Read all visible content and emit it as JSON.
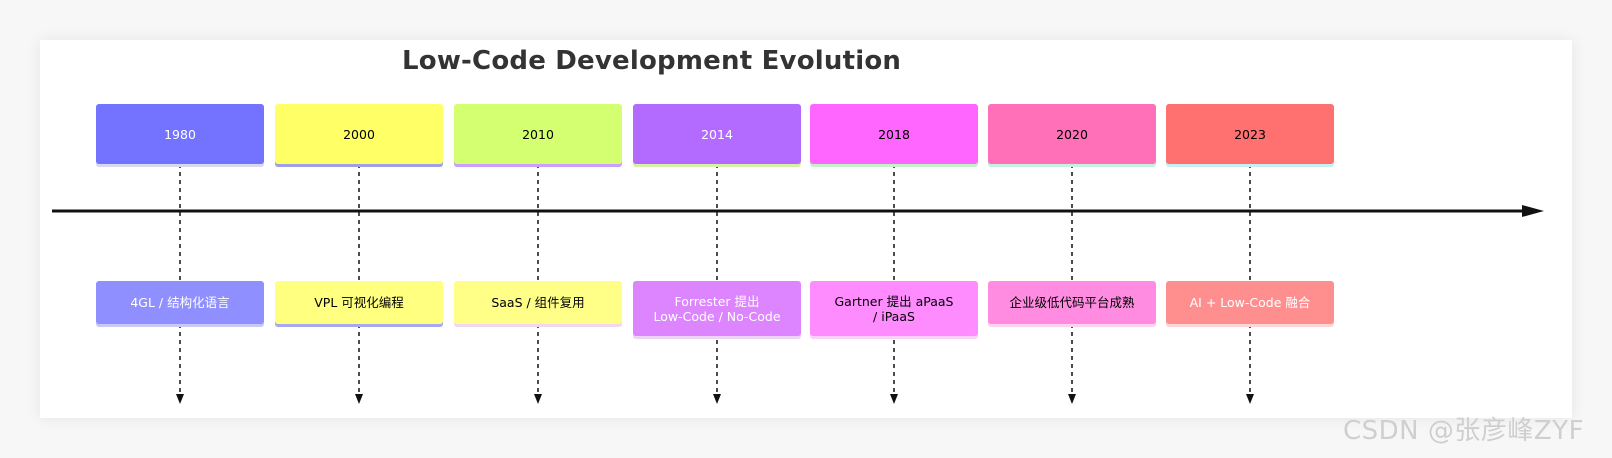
{
  "title": "Low-Code Development Evolution",
  "watermark": "CSDN @张彦峰ZYF",
  "milestones": [
    {
      "year": "1980",
      "event": "4GL / 结构化语言",
      "year_color": "#7373ff",
      "year_text_color": "#ffffff",
      "year_underline": "#d8d8f0",
      "event_color": "#8f8fff",
      "event_text_color": "#ffffff",
      "event_underline": "#c9c9f5"
    },
    {
      "year": "2000",
      "event": "VPL 可视化编程",
      "year_color": "#ffff66",
      "year_text_color": "#000000",
      "year_underline": "#9f9fe8",
      "event_color": "#ffff80",
      "event_text_color": "#000000",
      "event_underline": "#a8a8ee"
    },
    {
      "year": "2010",
      "event": "SaaS / 组件复用",
      "year_color": "#d4ff70",
      "year_text_color": "#000000",
      "year_underline": "#c9a0ff",
      "event_color": "#ffff88",
      "event_text_color": "#000000",
      "event_underline": "#f3d7ef"
    },
    {
      "year": "2014",
      "event": "Forrester 提出\nLow-Code / No-Code",
      "year_color": "#b36bff",
      "year_text_color": "#ffffff",
      "year_underline": "#d6f0a8",
      "event_color": "#dd85ff",
      "event_text_color": "#ffffff",
      "event_underline": "#ecd4f7"
    },
    {
      "year": "2018",
      "event": "Gartner 提出 aPaaS\n/ iPaaS",
      "year_color": "#ff66ff",
      "year_text_color": "#000000",
      "year_underline": "#c8f0c8",
      "event_color": "#ff8cff",
      "event_text_color": "#000000",
      "event_underline": "#fbd0fb"
    },
    {
      "year": "2020",
      "event": "企业级低代码平台成熟",
      "year_color": "#ff70b8",
      "year_text_color": "#000000",
      "year_underline": "#c8f0e0",
      "event_color": "#ff8ce0",
      "event_text_color": "#000000",
      "event_underline": "#fbd3ee"
    },
    {
      "year": "2023",
      "event": "AI + Low-Code 融合",
      "year_color": "#ff7070",
      "year_text_color": "#000000",
      "year_underline": "#c8f0f0",
      "event_color": "#ff8f8f",
      "event_text_color": "#ffffff",
      "event_underline": "#fbd6d6"
    }
  ]
}
